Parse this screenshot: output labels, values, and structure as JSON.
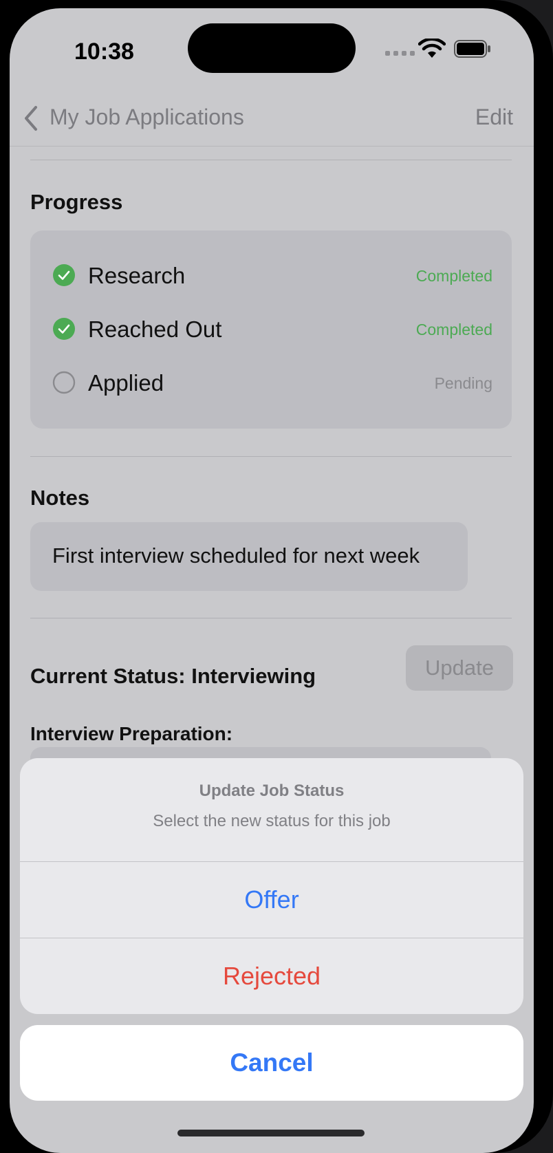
{
  "status_bar": {
    "time": "10:38"
  },
  "nav": {
    "back_label": "My Job Applications",
    "edit_label": "Edit"
  },
  "progress": {
    "title": "Progress",
    "steps": [
      {
        "label": "Research",
        "status": "Completed",
        "done": true
      },
      {
        "label": "Reached Out",
        "status": "Completed",
        "done": true
      },
      {
        "label": "Applied",
        "status": "Pending",
        "done": false
      }
    ]
  },
  "notes": {
    "title": "Notes",
    "text": "First interview scheduled for next week"
  },
  "status": {
    "current": "Current Status: Interviewing",
    "update_label": "Update",
    "prep_label": "Interview Preparation:"
  },
  "action_sheet": {
    "title": "Update Job Status",
    "message": "Select the new status for this job",
    "options": [
      "Offer",
      "Rejected"
    ],
    "cancel_label": "Cancel"
  },
  "colors": {
    "accent": "#3478f6",
    "destructive": "#e5493d",
    "success": "#4caa53"
  },
  "icons": [
    "back-chevron",
    "wifi",
    "battery",
    "checkmark-circle",
    "empty-circle"
  ]
}
